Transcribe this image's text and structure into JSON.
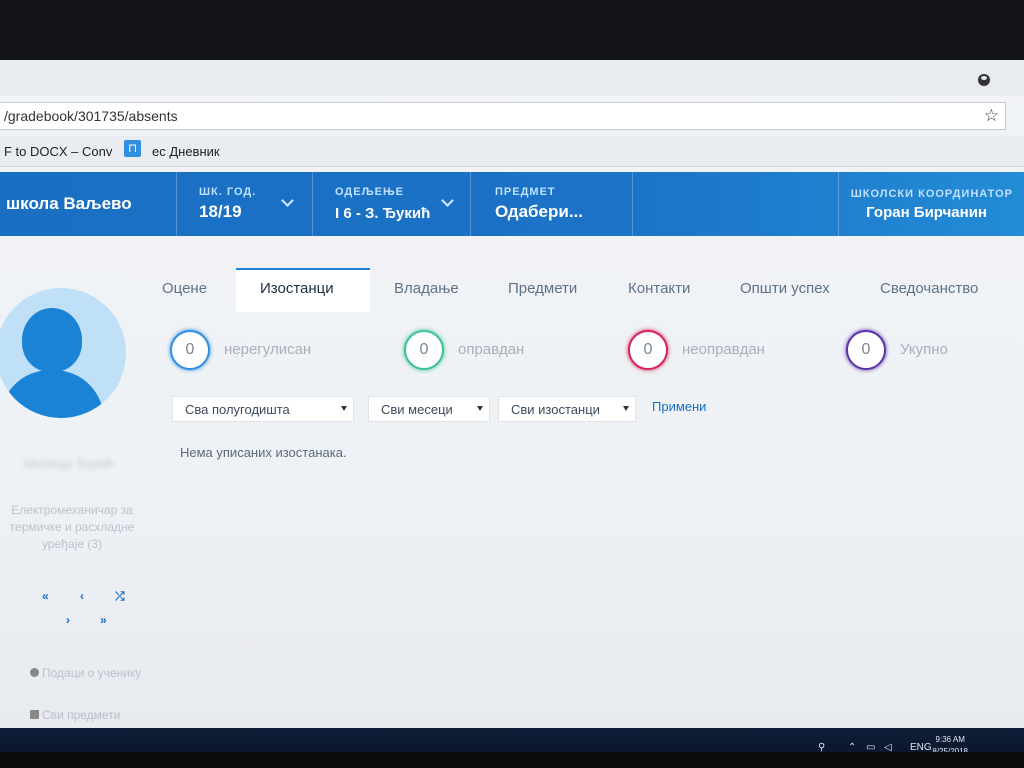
{
  "browser": {
    "url": "/gradebook/301735/absents",
    "bookmarks": [
      {
        "label": "F to DOCX – Conv"
      },
      {
        "label": "ес Дневник"
      }
    ]
  },
  "header": {
    "school": "школа Ваљево",
    "year_label": "ШК. ГОД.",
    "year_value": "18/19",
    "class_label": "ОДЕЉЕЊЕ",
    "class_value": "I 6 - З. Ђукић",
    "subject_label": "ПРЕДМЕТ",
    "subject_value": "Одабери...",
    "coordinator_label": "ШКОЛСКИ КООРДИНАТОР",
    "coordinator_name": "Горан Бирчанин"
  },
  "tabs": [
    {
      "label": "Оцене"
    },
    {
      "label": "Изостанци"
    },
    {
      "label": "Владање"
    },
    {
      "label": "Предмети"
    },
    {
      "label": "Контакти"
    },
    {
      "label": "Општи успех"
    },
    {
      "label": "Сведочанство"
    }
  ],
  "counters": [
    {
      "value": "0",
      "label": "нерегулисан",
      "color": "#2f8fe0"
    },
    {
      "value": "0",
      "label": "оправдан",
      "color": "#3fbf9a"
    },
    {
      "value": "0",
      "label": "неоправдан",
      "color": "#d6245c"
    },
    {
      "value": "0",
      "label": "Укупно",
      "color": "#5b35a8"
    }
  ],
  "filters": {
    "semester": "Сва полугодишта",
    "months": "Сви месеци",
    "absences": "Сви изостанци",
    "apply": "Примени"
  },
  "empty_message": "Нема уписаних изостанака.",
  "sidebar": {
    "student_name": "Милица Ђукић",
    "department": "Електромеханичар за термичке и расхладне уређаје (3)",
    "nav": {
      "first": "«",
      "prev": "‹",
      "random": "⤮",
      "next": "›",
      "last": "»"
    },
    "links": [
      {
        "label": "Подаци о ученику"
      },
      {
        "label": "Сви предмети"
      }
    ]
  },
  "taskbar": {
    "language": "ENG",
    "time": "9:36 AM",
    "date": "8/25/2018"
  }
}
